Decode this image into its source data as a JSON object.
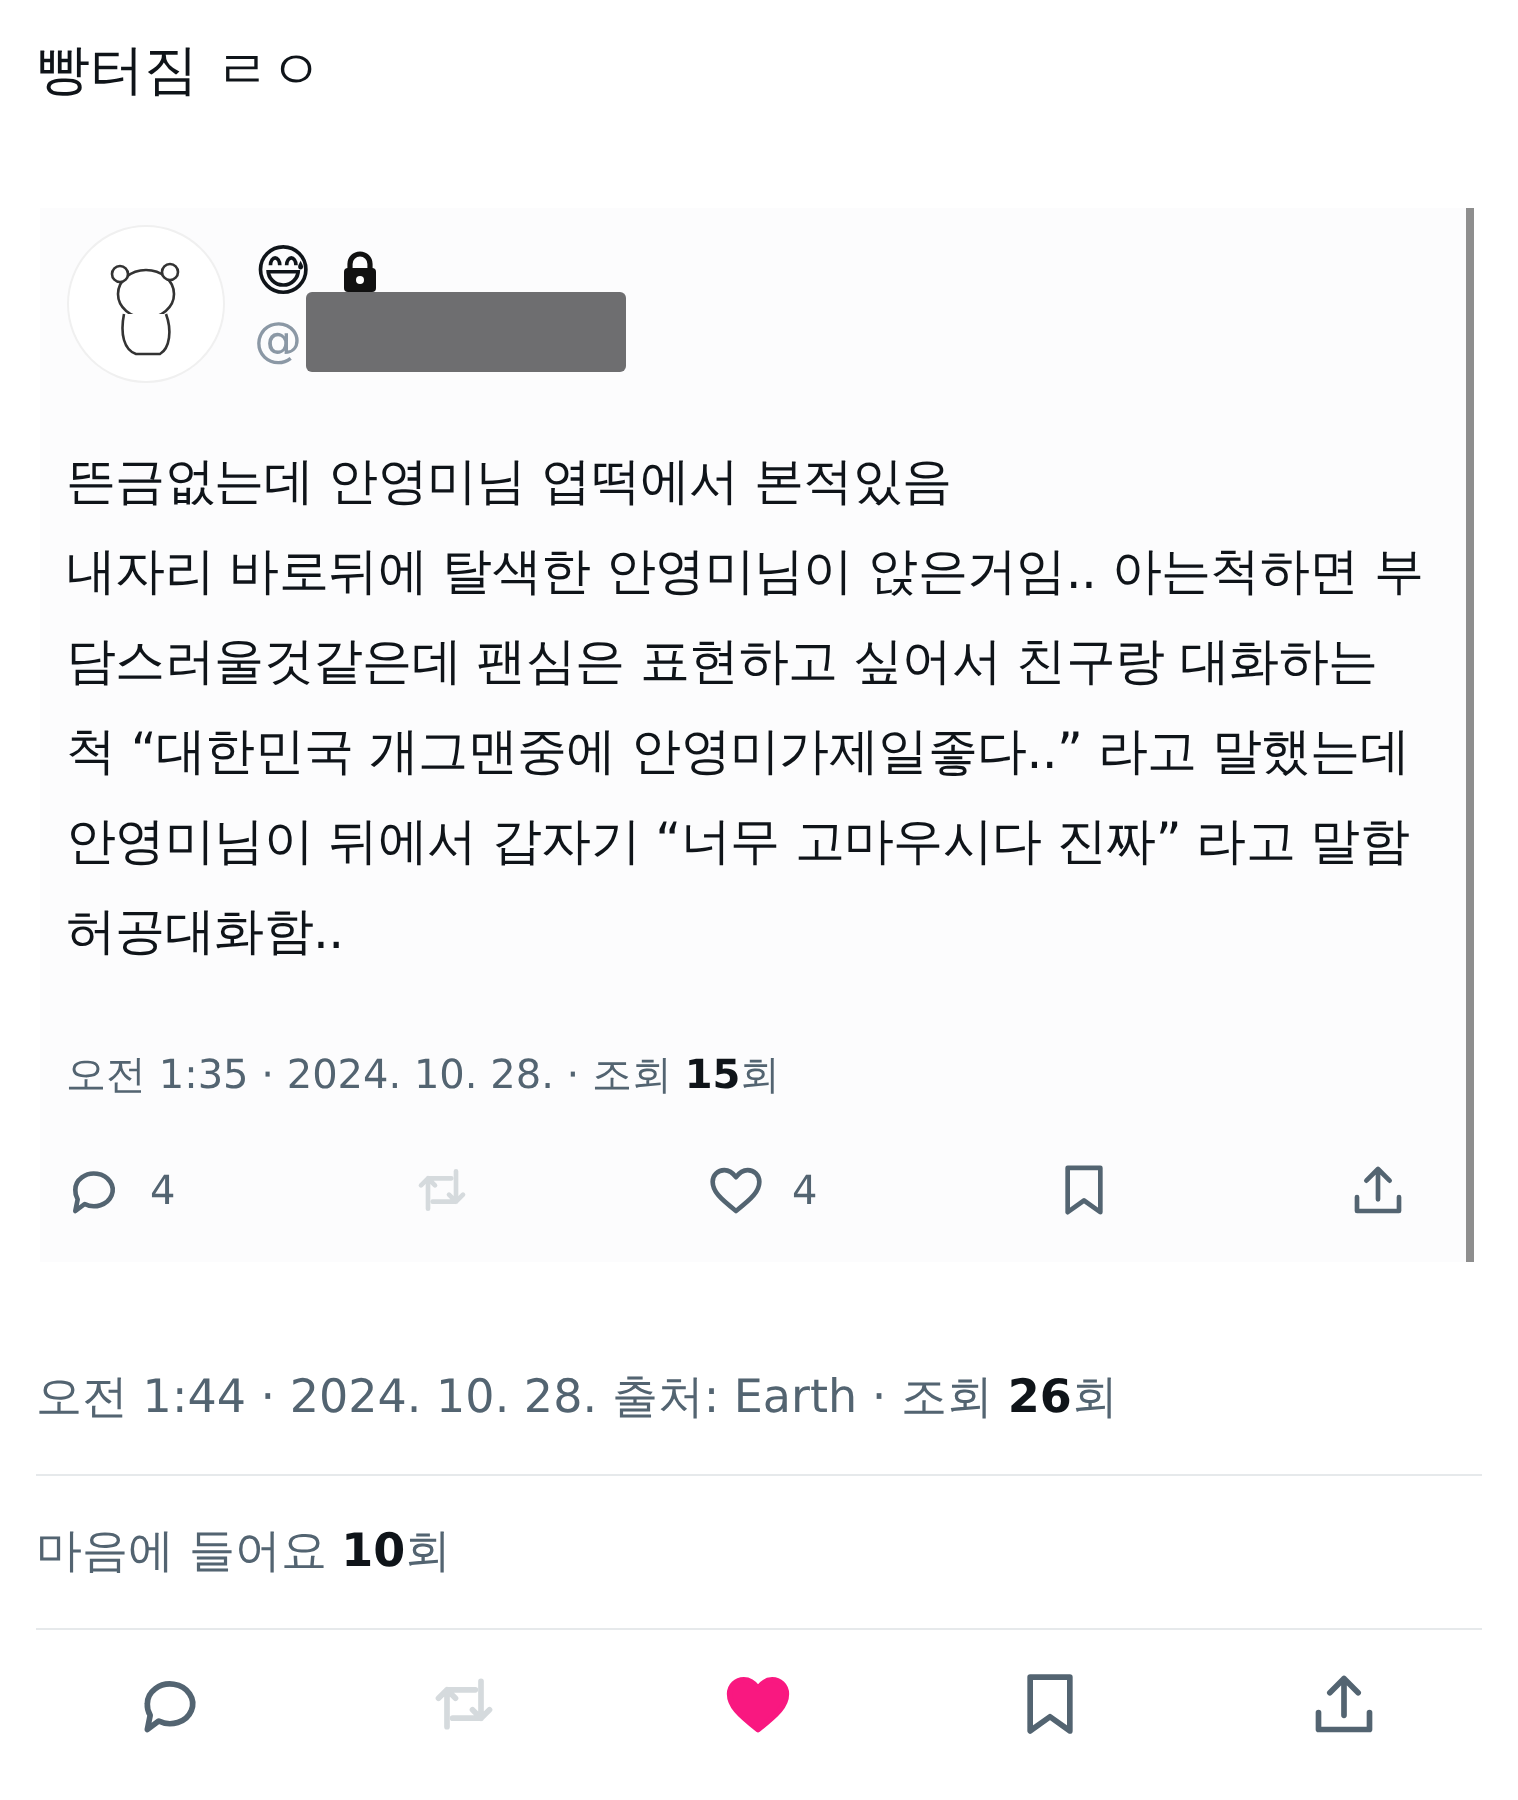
{
  "post_text": "빵터짐 ㄹㅇ",
  "quoted": {
    "name_emoji": "😅",
    "protected": true,
    "handle_prefix": "@",
    "body": "뜬금없는데 안영미님 엽떡에서 본적있음\n내자리 바로뒤에 탈색한 안영미님이 앉은거임.. 아는척하면 부담스러울것같은데 팬심은 표현하고 싶어서 친구랑 대화하는척 “대한민국 개그맨중에 안영미가제일좋다..” 라고 말했는데 안영미님이 뒤에서 갑자기 “너무 고마우시다 진짜” 라고 말함 허공대화함..",
    "meta": "오전 1:35 · 2024. 10. 28. · 조회 **15**회",
    "actions": [
      {
        "kind": "reply",
        "count": "4",
        "disabled": false,
        "liked": false
      },
      {
        "kind": "repost",
        "disabled": true,
        "liked": false
      },
      {
        "kind": "like",
        "count": "4",
        "disabled": false,
        "liked": false
      },
      {
        "kind": "bookmark",
        "disabled": false,
        "liked": false
      },
      {
        "kind": "share",
        "disabled": false,
        "liked": false
      }
    ]
  },
  "meta": "오전 1:44 · 2024. 10. 28. 출처: Earth · 조회 **26**회",
  "likes_line": "마음에 들어요 **10**회",
  "actions": [
    {
      "kind": "reply",
      "disabled": false,
      "liked": false
    },
    {
      "kind": "repost",
      "disabled": true,
      "liked": false
    },
    {
      "kind": "like",
      "disabled": false,
      "liked": true
    },
    {
      "kind": "bookmark",
      "disabled": false,
      "liked": false
    },
    {
      "kind": "share",
      "disabled": false,
      "liked": false
    }
  ]
}
